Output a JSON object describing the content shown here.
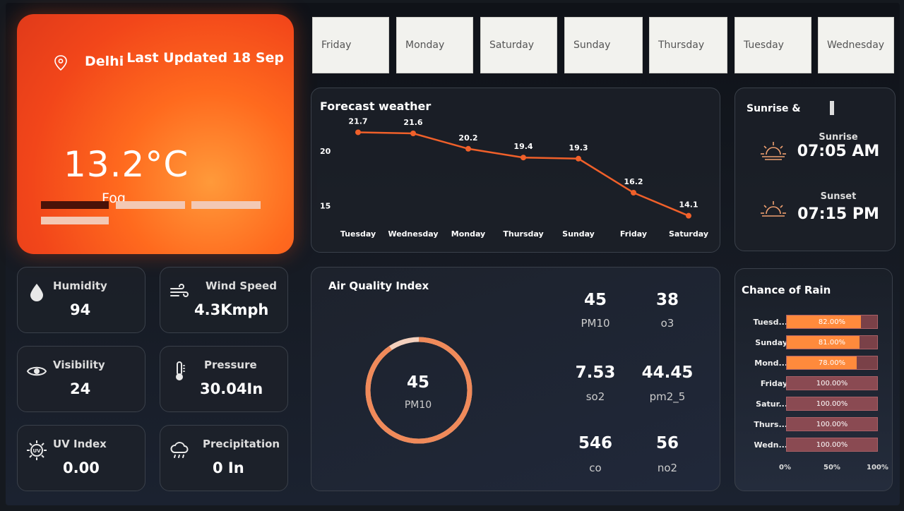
{
  "hero": {
    "city": "Delhi",
    "last_updated": "Last Updated 18 Sep",
    "temperature": "13.2°C",
    "condition": "Fog",
    "accent": "#f2461a"
  },
  "day_tabs": [
    "Friday",
    "Monday",
    "Saturday",
    "Sunday",
    "Thursday",
    "Tuesday",
    "Wednesday"
  ],
  "metrics": {
    "humidity": {
      "label": "Humidity",
      "value": "94",
      "icon": "droplet-icon"
    },
    "wind_speed": {
      "label": "Wind Speed",
      "value": "4.3Kmph",
      "icon": "wind-icon"
    },
    "visibility": {
      "label": "Visibility",
      "value": "24",
      "icon": "eye-icon"
    },
    "pressure": {
      "label": "Pressure",
      "value": "30.04In",
      "icon": "thermometer-icon"
    },
    "uv_index": {
      "label": "UV Index",
      "value": "0.00",
      "icon": "uv-sun-icon"
    },
    "precipitation": {
      "label": "Precipitation",
      "value": "0 In",
      "icon": "rain-cloud-icon"
    }
  },
  "forecast": {
    "title": "Forecast weather",
    "line_color": "#f0602a"
  },
  "sun": {
    "title": "Sunrise &",
    "sunrise_label": "Sunrise",
    "sunrise_time": "07:05 AM",
    "sunset_label": "Sunset",
    "sunset_time": "07:15 PM"
  },
  "aqi": {
    "title": "Air Quality Index",
    "gauge_value": "45",
    "gauge_label": "PM10",
    "gauge_color": "#f08a5a",
    "readings": [
      {
        "value": "45",
        "label": "PM10"
      },
      {
        "value": "38",
        "label": "o3"
      },
      {
        "value": "7.53",
        "label": "so2"
      },
      {
        "value": "44.45",
        "label": "pm2_5"
      },
      {
        "value": "546",
        "label": "co"
      },
      {
        "value": "56",
        "label": "no2"
      }
    ]
  },
  "rain": {
    "title": "Chance of Rain",
    "axis": [
      "0%",
      "50%",
      "100%"
    ]
  },
  "chart_data": [
    {
      "type": "line",
      "title": "Forecast weather",
      "categories": [
        "Tuesday",
        "Wednesday",
        "Monday",
        "Thursday",
        "Sunday",
        "Friday",
        "Saturday"
      ],
      "values": [
        21.7,
        21.6,
        20.2,
        19.4,
        19.3,
        16.2,
        14.1
      ],
      "data_labels": [
        "21.7",
        "21.6",
        "20.2",
        "19.4",
        "19.3",
        "16.2",
        "14.1"
      ],
      "y_ticks": [
        "20",
        "15"
      ],
      "ylim": [
        13.5,
        22.5
      ],
      "grid": false
    },
    {
      "type": "bar",
      "orientation": "horizontal",
      "title": "Chance of Rain",
      "categories": [
        "Tuesd...",
        "Sunday",
        "Mond...",
        "Friday",
        "Satur...",
        "Thurs...",
        "Wedn..."
      ],
      "values": [
        82,
        81,
        78,
        100,
        100,
        100,
        100
      ],
      "data_labels": [
        "82.00%",
        "81.00%",
        "78.00%",
        "100.00%",
        "100.00%",
        "100.00%",
        "100.00%"
      ],
      "x_ticks": [
        "0%",
        "50%",
        "100%"
      ],
      "xlim": [
        0,
        100
      ],
      "colors": {
        "highlight": "#ff8a3c",
        "normal": "#8a4a52"
      }
    }
  ]
}
